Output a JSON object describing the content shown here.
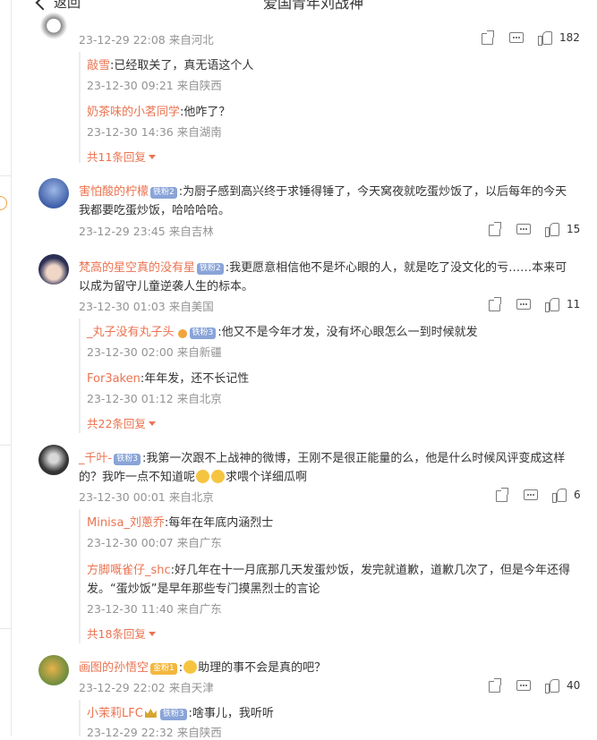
{
  "header": {
    "back_label": "返回",
    "title": "爱国青年刘战神"
  },
  "top_comment": {
    "meta": "23-12-29 22:08 来自河北",
    "likes": "182"
  },
  "thread1_replies": [
    {
      "user": "敲雪",
      "text": ":已经取关了，真无语这个人",
      "meta": "23-12-30 09:21 来自陕西"
    },
    {
      "user": "奶茶味的小茗同学",
      "text": ":他咋了？",
      "meta": "23-12-30 14:36 来自湖南"
    }
  ],
  "thread1_more": "共11条回复",
  "c2": {
    "user": "害怕酸的柠檬",
    "badge": "铁粉2",
    "line1": ":为厨子感到高兴终于求锤得锤了，今天窝夜就吃蛋炒饭了，以后每年的今天",
    "line2": "我都要吃蛋炒饭，哈哈哈哈。",
    "meta": "23-12-29 23:45 来自吉林",
    "likes": "15"
  },
  "c3": {
    "user": "梵高的星空真的没有星",
    "badge": "铁粉2",
    "line1": ":我更愿意相信他不是坏心眼的人，就是吃了没文化的亏……本来可",
    "line2": "以成为留守儿童逆袭人生的标本。",
    "meta": "23-12-30 01:03 来自美国",
    "likes": "11"
  },
  "thread3_replies": [
    {
      "user": "_丸子没有丸子头",
      "badge": "铁粉3",
      "text": ":他又不是今年才发，没有坏心眼怎么一到时候就发",
      "meta": "23-12-30 02:00 来自新疆"
    },
    {
      "user": "For3aken",
      "text": ":年年发，还不长记性",
      "meta": "23-12-30 01:12 来自北京"
    }
  ],
  "thread3_more": "共22条回复",
  "c4": {
    "user": "_千叶-",
    "badge": "铁粉3",
    "line1": ":我第一次跟不上战神的微博，王刚不是很正能量的么，他是什么时候风评变成这样",
    "line2a": "的？我咋一点不知道呢",
    "line2b": "求喂个详细瓜啊",
    "meta": "23-12-30 00:01 来自北京",
    "likes": "6"
  },
  "thread4_replies": [
    {
      "user": "Minisa_刘蔥乔",
      "text": ":每年在年底内涵烈士",
      "meta": "23-12-30 00:07 来自广东"
    },
    {
      "user": "方脚嘅雀仔_shc",
      "text": ":好几年在十一月底那几天发蛋炒饭，发完就道歉，道歉几次了，但是今年还得",
      "text2": "发。“蛋炒饭”是早年那些专门摸黑烈士的言论",
      "meta": "23-12-30 11:40 来自广东"
    }
  ],
  "thread4_more": "共18条回复",
  "c5": {
    "user": "画图的孙悟空",
    "badge": "金粉1",
    "text": "助理的事不会是真的吧？",
    "meta": "23-12-29 22:02 来自天津",
    "likes": "40"
  },
  "thread5_replies": [
    {
      "user": "小茉莉LFC",
      "badge": "铁粉3",
      "text": ":啥事儿，我听听",
      "meta": "23-12-29 22:32 来自陕西"
    }
  ],
  "colors": {
    "username": "#eb7350",
    "meta": "#939393",
    "badge": "#89a4d8"
  }
}
